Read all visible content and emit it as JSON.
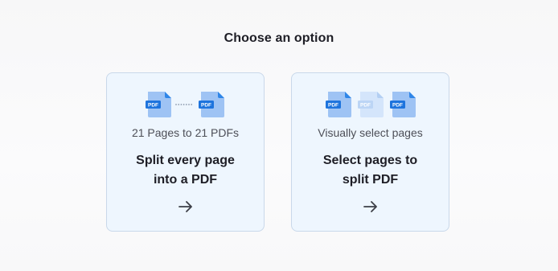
{
  "page": {
    "title": "Choose an option"
  },
  "options": [
    {
      "subtitle": "21 Pages to 21 PDFs",
      "heading_line1": "Split every page",
      "heading_line2": "into a PDF",
      "icons": [
        "pdf-file-icon",
        "dotted-connector-icon",
        "pdf-file-icon"
      ],
      "badge_text": "PDF",
      "arrow_icon": "arrow-right-icon"
    },
    {
      "subtitle": "Visually select pages",
      "heading_line1": "Select pages to",
      "heading_line2": "split PDF",
      "icons": [
        "pdf-file-icon",
        "pdf-file-faded-icon",
        "pdf-file-icon"
      ],
      "badge_text": "PDF",
      "arrow_icon": "arrow-right-icon"
    }
  ],
  "colors": {
    "card_background": "#eef6fe",
    "card_border": "#c9d8ea",
    "file_body": "#9ec3f4",
    "file_fold": "#2f86e8",
    "file_badge": "#1e74dd",
    "file_faded_body": "#d4e5fb",
    "file_faded_badge": "#bcd5f5"
  }
}
